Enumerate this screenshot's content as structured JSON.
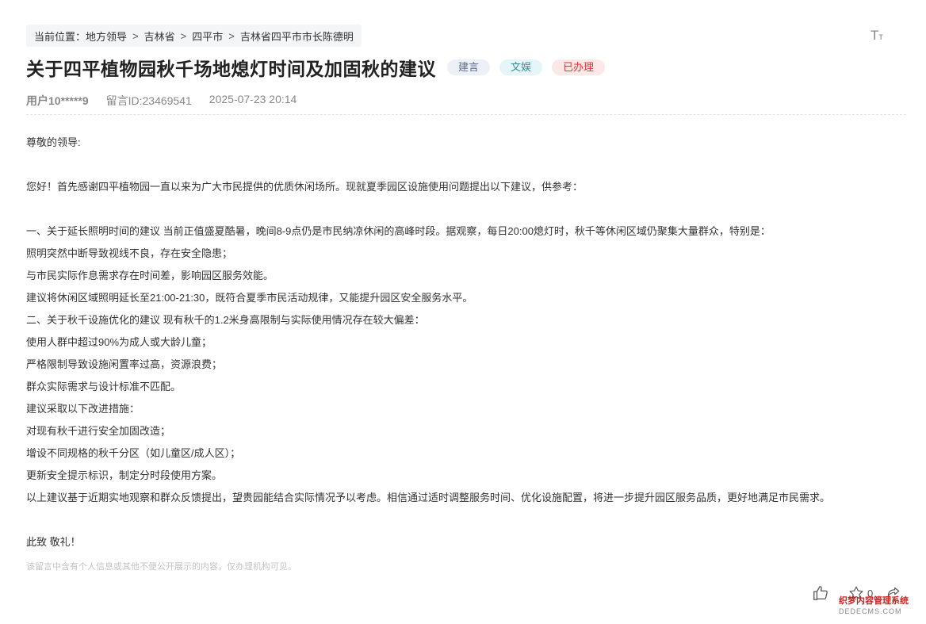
{
  "breadcrumb": {
    "prefix": "当前位置：",
    "items": [
      "地方领导",
      "吉林省",
      "四平市",
      "吉林省四平市市长陈德明"
    ],
    "separator": ">"
  },
  "font_size_tool": {
    "icon": "font-size-icon",
    "label": "Tт"
  },
  "post": {
    "title": "关于四平植物园秋千场地熄灯时间及加固秋的建议",
    "tags": {
      "type": "建言",
      "domain": "文娱",
      "status": "已办理"
    },
    "meta": {
      "user": "用户10*****9",
      "message_id": "留言ID:23469541",
      "time": "2025-07-23 20:14"
    }
  },
  "content": {
    "paragraphs": [
      "尊敬的领导:",
      "",
      "您好！首先感谢四平植物园一直以来为广大市民提供的优质休闲场所。现就夏季园区设施使用问题提出以下建议，供参考：",
      "",
      "一、关于延长照明时间的建议 当前正值盛夏酷暑，晚间8-9点仍是市民纳凉休闲的高峰时段。据观察，每日20:00熄灯时，秋千等休闲区域仍聚集大量群众，特别是：",
      "照明突然中断导致视线不良，存在安全隐患；",
      "与市民实际作息需求存在时间差，影响园区服务效能。",
      "建议将休闲区域照明延长至21:00-21:30，既符合夏季市民活动规律，又能提升园区安全服务水平。",
      "二、关于秋千设施优化的建议 现有秋千的1.2米身高限制与实际使用情况存在较大偏差：",
      "使用人群中超过90%为成人或大龄儿童；",
      "严格限制导致设施闲置率过高，资源浪费；",
      "群众实际需求与设计标准不匹配。",
      "建议采取以下改进措施：",
      "对现有秋千进行安全加固改造；",
      "增设不同规格的秋千分区（如儿童区/成人区）；",
      "更新安全提示标识，制定分时段使用方案。",
      "以上建议基于近期实地观察和群众反馈提出，望贵园能结合实际情况予以考虑。相信通过适时调整服务时间、优化设施配置，将进一步提升园区服务品质，更好地满足市民需求。",
      "",
      "此致 敬礼！"
    ]
  },
  "notice": "该留言中含有个人信息或其他不便公开展示的内容，仅办理机构可见。",
  "actions": {
    "like_icon": "thumbs-up-icon",
    "favorite_icon": "star-icon",
    "favorite_count": "0",
    "share_icon": "share-icon"
  },
  "watermark": {
    "line1": "织梦内容管理系统",
    "line2": "DEDECMS.COM"
  }
}
